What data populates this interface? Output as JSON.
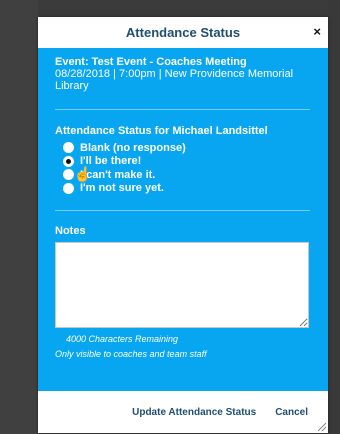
{
  "modal": {
    "title": "Attendance Status",
    "close_icon": "close-icon",
    "close_glyph": "×"
  },
  "event": {
    "title": "Event: Test Event - Coaches Meeting",
    "details": "08/28/2018 | 7:00pm | New Providence Memorial Library"
  },
  "attendance": {
    "heading": "Attendance Status for Michael Landsittel",
    "selected_index": 1,
    "options": [
      "Blank (no response)",
      "I'll be there!",
      "I can't make it.",
      "I'm not sure yet."
    ]
  },
  "notes": {
    "label": "Notes",
    "value": "",
    "chars_remaining": "4000 Characters Remaining",
    "visibility": "Only visible to coaches and team staff"
  },
  "footer": {
    "update_label": "Update Attendance Status",
    "cancel_label": "Cancel"
  },
  "colors": {
    "body_bg": "#08a5f1",
    "title_color": "#1e4f72",
    "backdrop": "#3b3b3b"
  }
}
